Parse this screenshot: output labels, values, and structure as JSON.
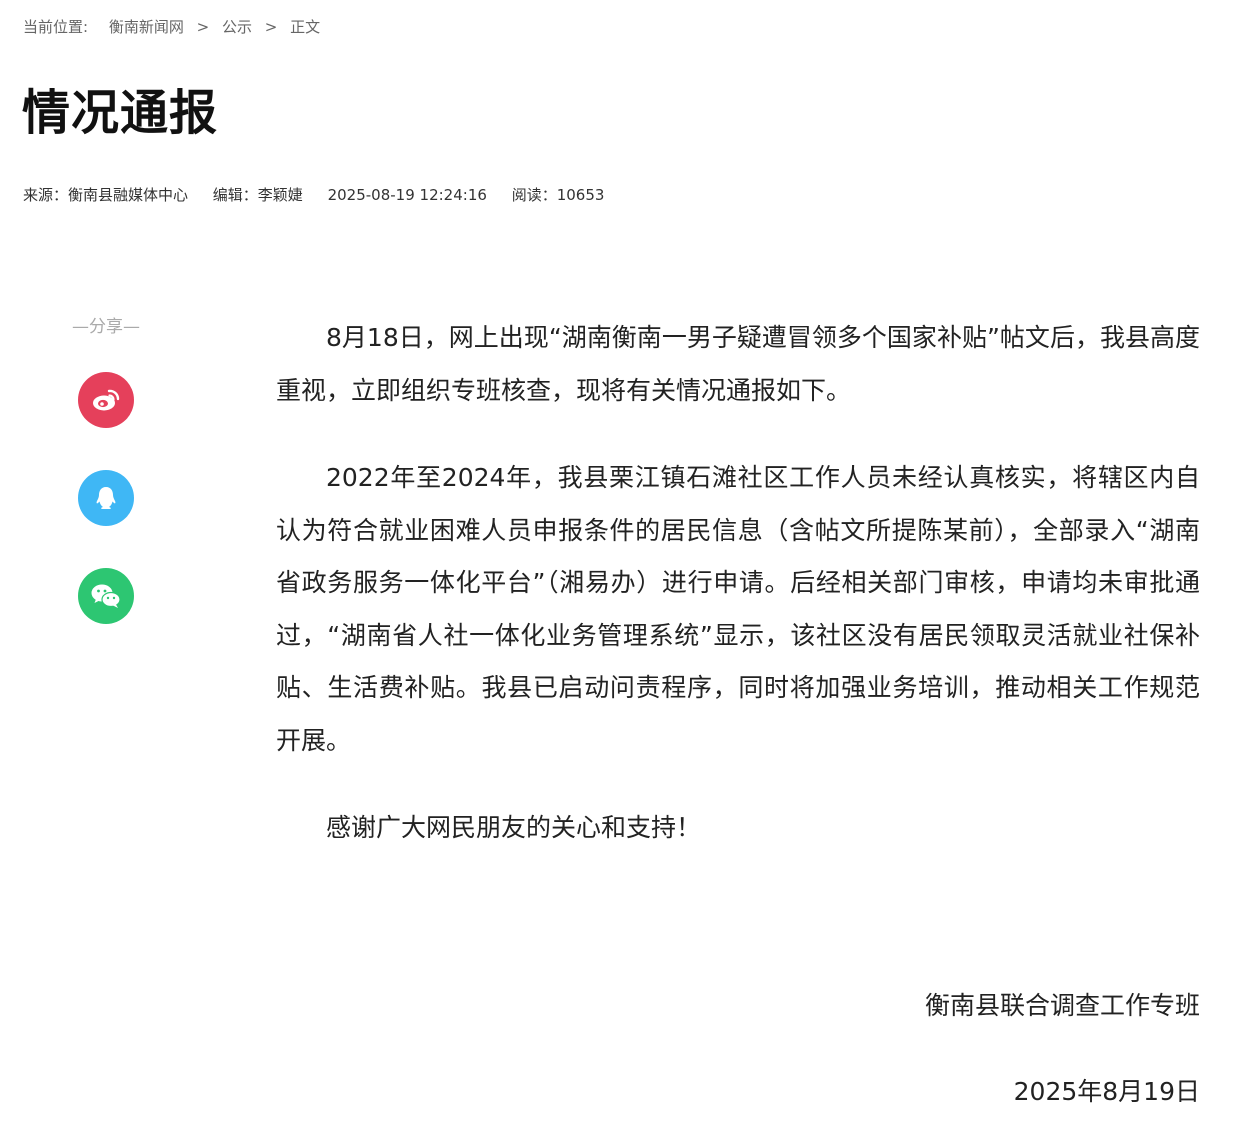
{
  "breadcrumb": {
    "lead": "当前位置:",
    "items": [
      "衡南新闻网",
      "公示",
      "正文"
    ],
    "separator": ">"
  },
  "article": {
    "title": "情况通报",
    "meta": {
      "source": "来源：衡南县融媒体中心",
      "editor": "编辑：李颖婕",
      "datetime": "2025-08-19 12:24:16",
      "reads": "阅读：10653"
    },
    "paragraphs": [
      "8月18日，网上出现“湖南衡南一男子疑遭冒领多个国家补贴”帖文后，我县高度重视，立即组织专班核查，现将有关情况通报如下。",
      "2022年至2024年，我县栗江镇石滩社区工作人员未经认真核实，将辖区内自认为符合就业困难人员申报条件的居民信息（含帖文所提陈某前），全部录入“湖南省政务服务一体化平台”（湘易办）进行申请。后经相关部门审核，申请均未审批通过，“湖南省人社一体化业务管理系统”显示，该社区没有居民领取灵活就业社保补贴、生活费补贴。我县已启动问责程序，同时将加强业务培训，推动相关工作规范开展。",
      "感谢广大网民朋友的关心和支持！"
    ],
    "signature": {
      "org": "衡南县联合调查工作专班",
      "date": "2025年8月19日"
    }
  },
  "share": {
    "label": "—分享—",
    "buttons": [
      {
        "icon": "weibo-icon",
        "color": "#e5405b"
      },
      {
        "icon": "qq-icon",
        "color": "#3fb7f5"
      },
      {
        "icon": "wechat-icon",
        "color": "#2dc672"
      }
    ]
  }
}
